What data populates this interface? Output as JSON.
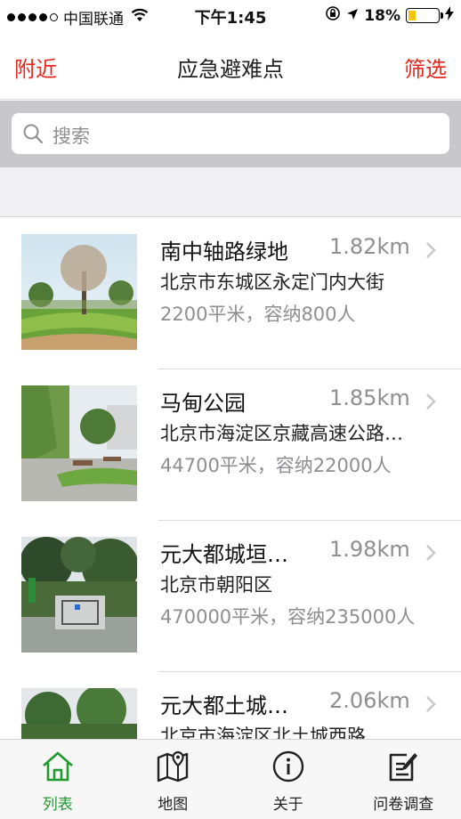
{
  "status_bar": {
    "carrier": "中国联通",
    "time": "下午1:45",
    "battery": "18%",
    "battery_level": 0.18,
    "icons": [
      "signal-dots",
      "wifi-icon",
      "lock-rotation-icon",
      "location-arrow-icon",
      "battery-icon",
      "charging-icon"
    ]
  },
  "nav": {
    "left": "附近",
    "title": "应急避难点",
    "right": "筛选",
    "accent_color": "#e8281f"
  },
  "search": {
    "placeholder": "搜索"
  },
  "list": [
    {
      "title": "南中轴路绿地",
      "distance": "1.82km",
      "address": "北京市东城区永定门内大街",
      "capacity": "2200平米，容纳800人"
    },
    {
      "title": "马甸公园",
      "distance": "1.85km",
      "address": "北京市海淀区京藏高速公路…",
      "capacity": "44700平米，容纳22000人"
    },
    {
      "title": "元大都城垣…",
      "distance": "1.98km",
      "address": "北京市朝阳区",
      "capacity": "470000平米，容纳235000人"
    },
    {
      "title": "元大都土城…",
      "distance": "2.06km",
      "address": "北京市海淀区北土城西路",
      "capacity": ""
    }
  ],
  "tabbar": {
    "active_color": "#1f9a2e",
    "tabs": [
      {
        "label": "列表",
        "icon": "home-icon",
        "active": true
      },
      {
        "label": "地图",
        "icon": "map-icon",
        "active": false
      },
      {
        "label": "关于",
        "icon": "info-icon",
        "active": false
      },
      {
        "label": "问卷调查",
        "icon": "survey-icon",
        "active": false
      }
    ]
  }
}
